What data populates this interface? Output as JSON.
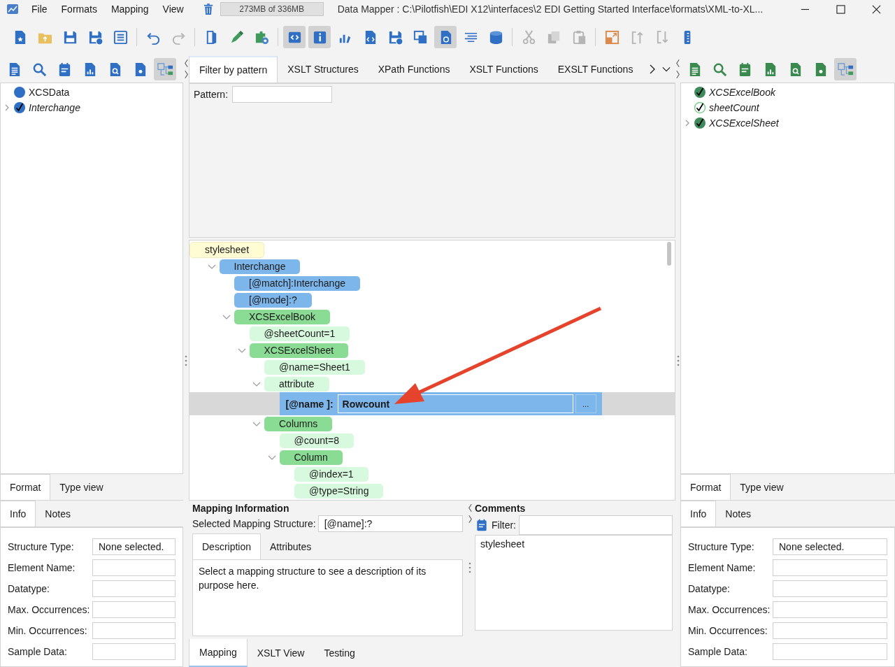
{
  "window": {
    "menus": [
      "File",
      "Formats",
      "Mapping",
      "View"
    ],
    "memory": "273MB of 336MB",
    "title": "Data Mapper : C:\\Pilotfish\\EDI X12\\interfaces\\2 EDI Getting Started Interface\\formats\\XML-to-XL..."
  },
  "toolbar_groups": [
    [
      {
        "pressed": false,
        "disabled": false
      },
      {
        "pressed": false,
        "disabled": false
      },
      {
        "pressed": false,
        "disabled": false
      },
      {
        "pressed": false,
        "disabled": false
      },
      {
        "pressed": false,
        "disabled": false
      }
    ],
    [
      {
        "pressed": false,
        "disabled": false
      },
      {
        "pressed": false,
        "disabled": true
      }
    ],
    [
      {
        "pressed": false,
        "disabled": false
      },
      {
        "pressed": false,
        "disabled": false
      },
      {
        "pressed": false,
        "disabled": false
      }
    ],
    [
      {
        "pressed": true,
        "disabled": false
      },
      {
        "pressed": true,
        "disabled": false
      },
      {
        "pressed": false,
        "disabled": false
      },
      {
        "pressed": false,
        "disabled": false
      },
      {
        "pressed": false,
        "disabled": false
      },
      {
        "pressed": false,
        "disabled": false
      },
      {
        "pressed": true,
        "disabled": false
      },
      {
        "pressed": false,
        "disabled": false
      },
      {
        "pressed": false,
        "disabled": false
      }
    ],
    [
      {
        "pressed": false,
        "disabled": true
      },
      {
        "pressed": false,
        "disabled": true
      },
      {
        "pressed": false,
        "disabled": true
      }
    ],
    [
      {
        "pressed": false,
        "disabled": false
      },
      {
        "pressed": false,
        "disabled": true
      },
      {
        "pressed": false,
        "disabled": true
      },
      {
        "pressed": false,
        "disabled": false
      }
    ]
  ],
  "source": {
    "tools": [
      {
        "pressed": false
      },
      {
        "pressed": false
      },
      {
        "pressed": false
      },
      {
        "pressed": false
      },
      {
        "pressed": false
      },
      {
        "pressed": false
      },
      {
        "pressed": true
      }
    ],
    "tree": [
      {
        "label": "XCSData",
        "kind": "root",
        "children": [
          {
            "label": "Interchange",
            "kind": "element",
            "expanded": false
          }
        ]
      }
    ],
    "tabs": [
      {
        "label": "Format",
        "selected": true
      },
      {
        "label": "Type view",
        "selected": false
      }
    ],
    "info_tabs": [
      {
        "label": "Info",
        "selected": true
      },
      {
        "label": "Notes",
        "selected": false
      }
    ],
    "fields": [
      {
        "label": "Structure Type:",
        "value": "None selected."
      },
      {
        "label": "Element Name:"
      },
      {
        "label": "Datatype:"
      },
      {
        "label": "Max. Occurrences:"
      },
      {
        "label": "Min. Occurrences:"
      },
      {
        "label": "Sample Data:"
      }
    ]
  },
  "center": {
    "tabs": [
      {
        "label": "Filter by pattern",
        "selected": true
      },
      {
        "label": "XSLT Structures",
        "selected": false
      },
      {
        "label": "XPath Functions",
        "selected": false
      },
      {
        "label": "XSLT Functions",
        "selected": false
      },
      {
        "label": "EXSLT Functions",
        "selected": false
      }
    ],
    "pattern": {
      "label": "Pattern:"
    },
    "mapping_tree": [
      {
        "label": "stylesheet",
        "kind": "root",
        "selected": false,
        "children": [
          {
            "label": "Interchange",
            "kind": "template",
            "selected": false,
            "expanded": true,
            "children": [
              {
                "label": "[@match]:Interchange",
                "kind": "template",
                "selected": false
              },
              {
                "label": "[@mode]:?",
                "kind": "template",
                "selected": false
              },
              {
                "label": "XCSExcelBook",
                "kind": "element",
                "selected": false,
                "expanded": true,
                "children": [
                  {
                    "label": "@sheetCount=1",
                    "kind": "attribute",
                    "selected": false
                  },
                  {
                    "label": "XCSExcelSheet",
                    "kind": "element",
                    "selected": false,
                    "expanded": true,
                    "children": [
                      {
                        "label": "@name=Sheet1",
                        "kind": "attribute",
                        "selected": false
                      },
                      {
                        "label": "attribute",
                        "kind": "attribute",
                        "selected": false,
                        "expanded": true,
                        "children": [
                          {
                            "label": "[@name ]:",
                            "value": "Rowcount",
                            "button": "...",
                            "kind": "editor",
                            "selected": true
                          }
                        ]
                      },
                      {
                        "label": "Columns",
                        "kind": "element",
                        "selected": false,
                        "expanded": true,
                        "children": [
                          {
                            "label": "@count=8",
                            "kind": "attribute",
                            "selected": false
                          },
                          {
                            "label": "Column",
                            "kind": "element",
                            "selected": false,
                            "expanded": true,
                            "children": [
                              {
                                "label": "@index=1",
                                "kind": "attribute",
                                "selected": false
                              },
                              {
                                "label": "@type=String",
                                "kind": "attribute",
                                "selected": false
                              }
                            ]
                          }
                        ]
                      }
                    ]
                  }
                ]
              }
            ]
          }
        ]
      }
    ],
    "mapping_info": {
      "title": "Mapping Information",
      "structure_label": "Selected Mapping Structure:",
      "structure_value": "[@name]:?",
      "tabs": [
        {
          "label": "Description",
          "selected": true
        },
        {
          "label": "Attributes",
          "selected": false
        }
      ],
      "description": "Select a mapping structure to see a description of its purpose here."
    },
    "comments": {
      "title": "Comments",
      "filter_label": "Filter:",
      "items": [
        "stylesheet"
      ]
    },
    "bottom_tabs": [
      {
        "label": "Mapping",
        "selected": true
      },
      {
        "label": "XSLT View",
        "selected": false
      },
      {
        "label": "Testing",
        "selected": false
      }
    ]
  },
  "target": {
    "tools": [
      {
        "pressed": false
      },
      {
        "pressed": false
      },
      {
        "pressed": false
      },
      {
        "pressed": false
      },
      {
        "pressed": false
      },
      {
        "pressed": false
      },
      {
        "pressed": true
      }
    ],
    "tree": [
      {
        "label": "XCSExcelBook",
        "kind": "element",
        "children": [
          {
            "label": "sheetCount",
            "kind": "attribute"
          },
          {
            "label": "XCSExcelSheet",
            "kind": "element",
            "expanded": false
          }
        ]
      }
    ],
    "tabs": [
      {
        "label": "Format",
        "selected": true
      },
      {
        "label": "Type view",
        "selected": false
      }
    ],
    "info_tabs": [
      {
        "label": "Info",
        "selected": true
      },
      {
        "label": "Notes",
        "selected": false
      }
    ],
    "fields": [
      {
        "label": "Structure Type:",
        "value": "None selected."
      },
      {
        "label": "Element Name:"
      },
      {
        "label": "Datatype:"
      },
      {
        "label": "Max. Occurrences:"
      },
      {
        "label": "Min. Occurrences:"
      },
      {
        "label": "Sample Data:"
      }
    ]
  }
}
